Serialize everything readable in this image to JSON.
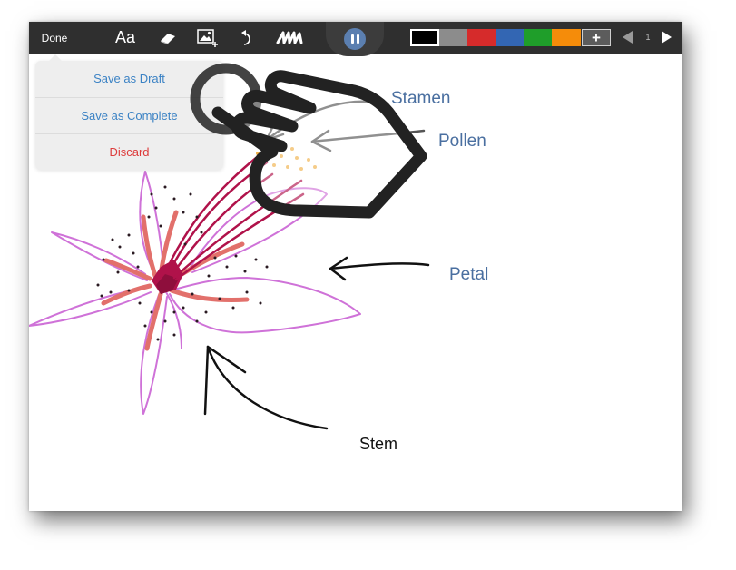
{
  "toolbar": {
    "done_label": "Done",
    "text_tool_label": "Aa",
    "tool_icons": [
      "eraser-icon",
      "insert-image-icon",
      "undo-icon",
      "scribble-brush-icon",
      "pause-icon"
    ],
    "swatches": [
      {
        "name": "black",
        "color": "#000000",
        "selected": true
      },
      {
        "name": "gray",
        "color": "#8c8c8c",
        "selected": false
      },
      {
        "name": "red",
        "color": "#d62b2b",
        "selected": false
      },
      {
        "name": "blue",
        "color": "#3366b3",
        "selected": false
      },
      {
        "name": "green",
        "color": "#1f9e2a",
        "selected": false
      },
      {
        "name": "orange",
        "color": "#f58c0a",
        "selected": false
      }
    ],
    "add_color_label": "+",
    "page_number": "1"
  },
  "save_menu": {
    "items": [
      {
        "label": "Save as Draft",
        "color": "#3b82c4"
      },
      {
        "label": "Save as Complete",
        "color": "#3b82c4"
      },
      {
        "label": "Discard",
        "color": "#dd3b3b"
      }
    ]
  },
  "canvas": {
    "labels": {
      "stamen": "Stamen",
      "pollen": "Pollen",
      "petal": "Petal",
      "stem": "Stem"
    },
    "colors": {
      "petal_outline": "#cf72d8",
      "center": "#b0124a",
      "petal_stripes": "#e2706b",
      "stamen_lines": "#b0124a",
      "pollen_dots": "#f0b14a",
      "arrows_gray": "#555555",
      "arrows_black": "#111111"
    }
  },
  "overlay": {
    "hand_icon": "tap-hand-gesture-icon"
  }
}
